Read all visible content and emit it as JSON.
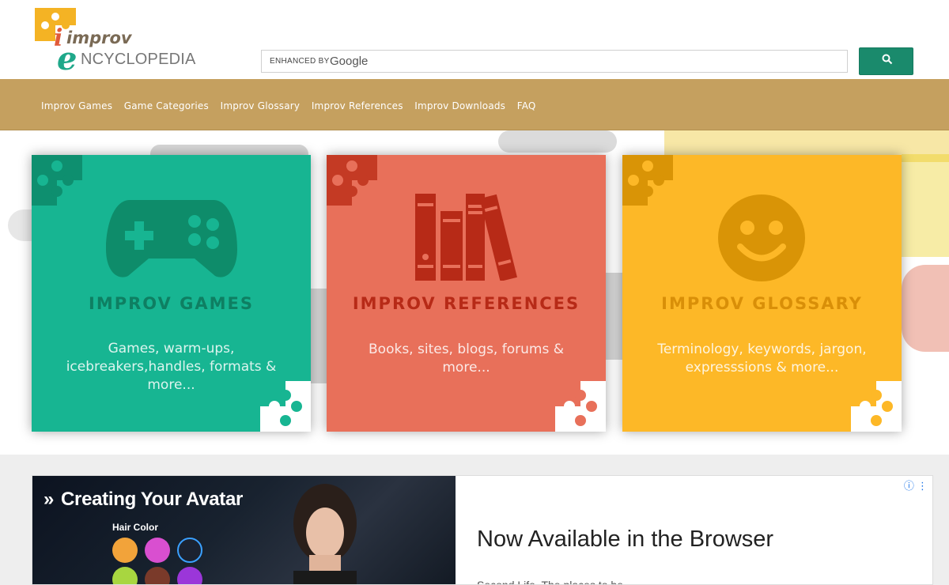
{
  "logo": {
    "line1": "improv",
    "line2": "NCYCLOPEDIA",
    "icon": "puzzle-logo-icon"
  },
  "search": {
    "enhanced_label": "ENHANCED BY",
    "google_label": "Google",
    "button_icon": "search-icon"
  },
  "nav": {
    "items": [
      {
        "label": "Improv Games"
      },
      {
        "label": "Game Categories"
      },
      {
        "label": "Improv Glossary"
      },
      {
        "label": "Improv References"
      },
      {
        "label": "Improv Downloads"
      },
      {
        "label": "FAQ"
      }
    ]
  },
  "cards": [
    {
      "title": "IMPROV GAMES",
      "description": "Games, warm-ups, icebreakers,handles, formats & more...",
      "icon": "gamepad-icon",
      "color": "#17b592"
    },
    {
      "title": "IMPROV REFERENCES",
      "description": "Books, sites, blogs, forums & more...",
      "icon": "books-icon",
      "color": "#e8705a"
    },
    {
      "title": "IMPROV GLOSSARY",
      "description": "Terminology, keywords, jargon, expresssions & more...",
      "icon": "smiley-icon",
      "color": "#fdb827"
    }
  ],
  "ad": {
    "chevron": "»",
    "headline": "Creating Your Avatar",
    "hair_label": "Hair Color",
    "title": "Now Available in the Browser",
    "subtitle": "Second Life. The places to be...",
    "info_icon": "ad-info-icon"
  }
}
